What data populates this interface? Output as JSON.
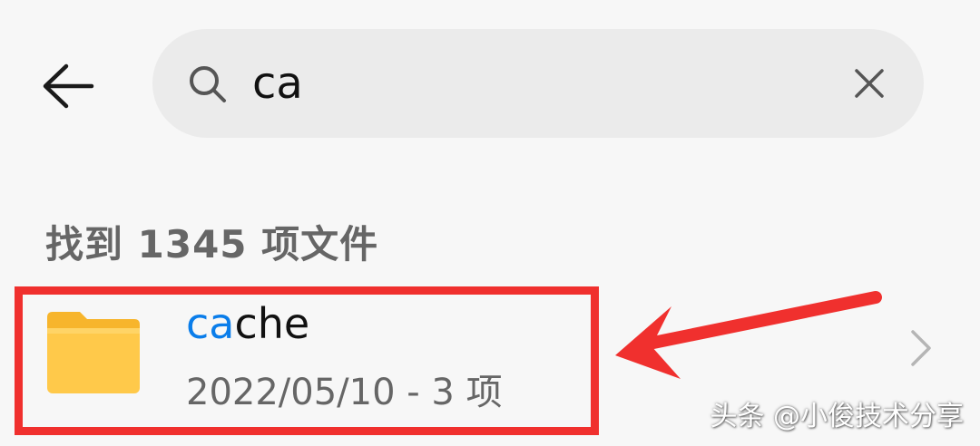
{
  "header": {
    "back_icon": "arrow-left-icon",
    "search": {
      "value": "ca",
      "search_icon": "search-icon",
      "clear_icon": "close-icon"
    }
  },
  "results": {
    "count_label": "找到 1345 项文件"
  },
  "items": [
    {
      "title_match": "ca",
      "title_rest": "che",
      "meta": "2022/05/10 - 3 项",
      "icon": "folder-icon",
      "trailing_icon": "chevron-right-icon"
    }
  ],
  "annotation": {
    "color": "#f0302e"
  },
  "watermark": "头条 @小俊技术分享",
  "colors": {
    "background": "#f7f7f7",
    "search_bg": "#ebebeb",
    "match_highlight": "#0a7dea",
    "folder": "#ffc94a",
    "folder_tab": "#f7b52c",
    "annotation_red": "#f0302e"
  }
}
